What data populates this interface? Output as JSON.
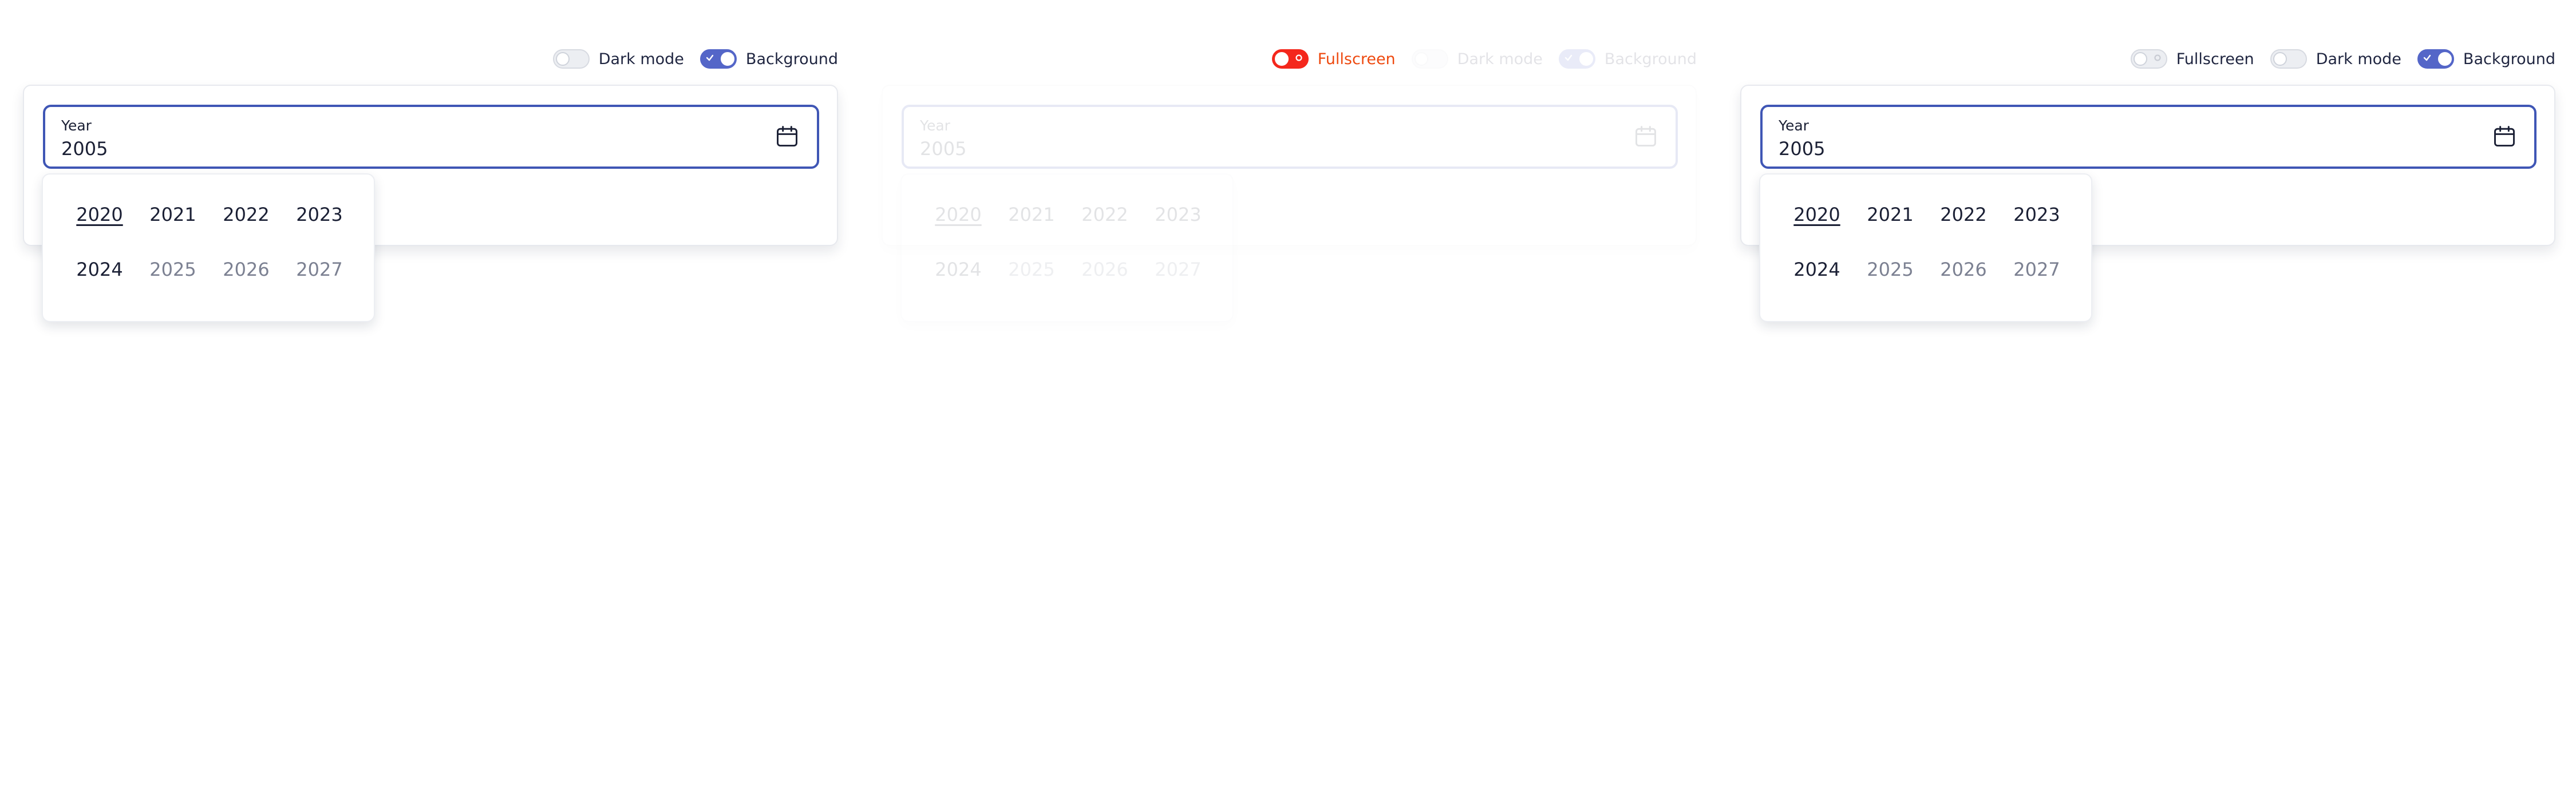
{
  "colors": {
    "accent": "#3f56b5",
    "toggle_on": "#5466c8",
    "toggle_fullscreen_on": "#f4271c",
    "fullscreen_label": "#ee4a10",
    "muted_year": "#7c8192"
  },
  "icons": {
    "calendar": "calendar-icon",
    "check": "check-icon"
  },
  "panels": [
    {
      "toggles": [
        {
          "label": "Dark mode",
          "on": false
        },
        {
          "label": "Background",
          "on": true
        }
      ],
      "field": {
        "label": "Year",
        "value": "2005"
      },
      "years": [
        {
          "label": "2020",
          "current": true,
          "muted": false
        },
        {
          "label": "2021",
          "current": false,
          "muted": false
        },
        {
          "label": "2022",
          "current": false,
          "muted": false
        },
        {
          "label": "2023",
          "current": false,
          "muted": false
        },
        {
          "label": "2024",
          "current": false,
          "muted": false
        },
        {
          "label": "2025",
          "current": false,
          "muted": true
        },
        {
          "label": "2026",
          "current": false,
          "muted": true
        },
        {
          "label": "2027",
          "current": false,
          "muted": true
        }
      ]
    },
    {
      "toggles": [
        {
          "label": "Fullscreen",
          "on": true
        },
        {
          "label": "Dark mode",
          "on": false
        },
        {
          "label": "Background",
          "on": true
        }
      ],
      "field": {
        "label": "Year",
        "value": "2005"
      },
      "years": [
        {
          "label": "2020",
          "current": true,
          "muted": false
        },
        {
          "label": "2021",
          "current": false,
          "muted": false
        },
        {
          "label": "2022",
          "current": false,
          "muted": false
        },
        {
          "label": "2023",
          "current": false,
          "muted": false
        },
        {
          "label": "2024",
          "current": false,
          "muted": false
        },
        {
          "label": "2025",
          "current": false,
          "muted": true
        },
        {
          "label": "2026",
          "current": false,
          "muted": true
        },
        {
          "label": "2027",
          "current": false,
          "muted": true
        }
      ]
    },
    {
      "toggles": [
        {
          "label": "Fullscreen",
          "on": false
        },
        {
          "label": "Dark mode",
          "on": false
        },
        {
          "label": "Background",
          "on": true
        }
      ],
      "field": {
        "label": "Year",
        "value": "2005"
      },
      "years": [
        {
          "label": "2020",
          "current": true,
          "muted": false
        },
        {
          "label": "2021",
          "current": false,
          "muted": false
        },
        {
          "label": "2022",
          "current": false,
          "muted": false
        },
        {
          "label": "2023",
          "current": false,
          "muted": false
        },
        {
          "label": "2024",
          "current": false,
          "muted": false
        },
        {
          "label": "2025",
          "current": false,
          "muted": true
        },
        {
          "label": "2026",
          "current": false,
          "muted": true
        },
        {
          "label": "2027",
          "current": false,
          "muted": true
        }
      ]
    }
  ]
}
